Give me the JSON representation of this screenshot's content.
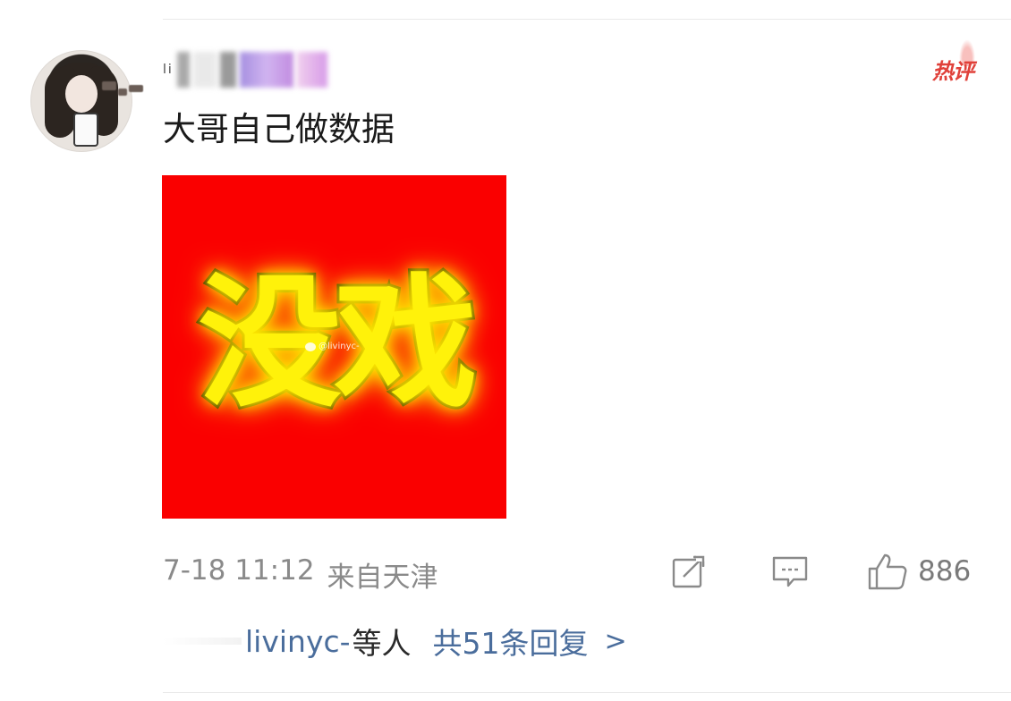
{
  "comment": {
    "username_partial": "li",
    "text": "大哥自己做数据",
    "hot_badge": "热评",
    "image": {
      "main_text": "没戏",
      "watermark": "@livinyc-",
      "background_color": "#fa0000",
      "text_color": "#fff20a"
    },
    "date": "7-18 11:12",
    "location": "来自天津",
    "like_count": "886",
    "replies": {
      "replier_name": "livinyc-",
      "suffix": "等人",
      "total": "共51条回复",
      "chevron": ">"
    }
  },
  "icons": {
    "share": "share-icon",
    "comment": "comment-icon",
    "like": "thumbs-up-icon",
    "avatar": "avatar-image"
  },
  "colors": {
    "link": "#4a6d9c",
    "meta": "#8a8a8a",
    "hot": "#e0413a"
  }
}
